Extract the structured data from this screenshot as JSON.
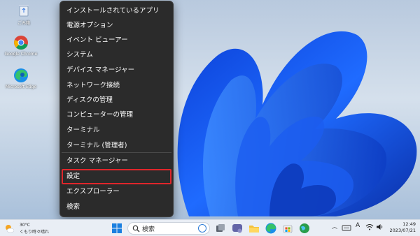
{
  "desktop": {
    "icons": [
      {
        "label": "ごみ箱",
        "icon": "recycle-bin-icon"
      },
      {
        "label": "Google Chrome",
        "icon": "chrome-icon"
      },
      {
        "label": "Microsoft Edge",
        "icon": "edge-icon"
      }
    ]
  },
  "context_menu": {
    "items": [
      {
        "label": "インストールされているアプリ"
      },
      {
        "label": "電源オプション"
      },
      {
        "label": "イベント ビューアー"
      },
      {
        "label": "システム"
      },
      {
        "label": "デバイス マネージャー"
      },
      {
        "label": "ネットワーク接続"
      },
      {
        "label": "ディスクの管理"
      },
      {
        "label": "コンピューターの管理"
      },
      {
        "label": "ターミナル"
      },
      {
        "label": "ターミナル (管理者)"
      },
      {
        "label": "タスク マネージャー"
      },
      {
        "label": "設定",
        "highlighted": true
      },
      {
        "label": "エクスプローラー"
      },
      {
        "label": "検索"
      }
    ],
    "highlight_color": "#e0262b"
  },
  "taskbar": {
    "weather": {
      "temp": "30°C",
      "condition": "くもり時々晴れ"
    },
    "search_placeholder": "検索",
    "tray": {
      "ime": "A"
    },
    "clock": {
      "time": "12:49",
      "date": "2023/07/21"
    }
  }
}
